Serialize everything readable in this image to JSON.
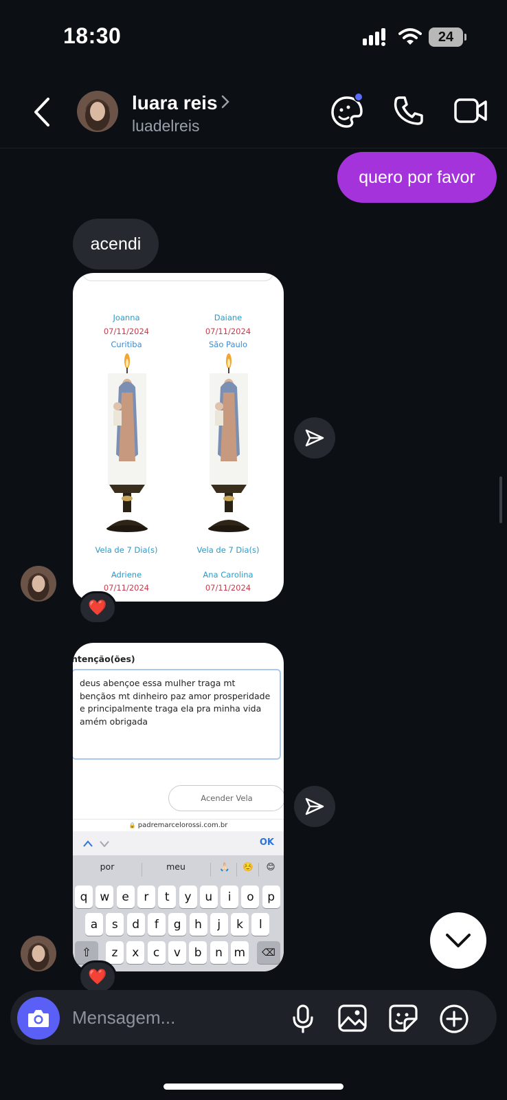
{
  "status": {
    "time": "18:30",
    "battery": "24"
  },
  "header": {
    "name": "luara reis",
    "username": "luadelreis"
  },
  "messages": {
    "outgoing_1": "quero por favor",
    "incoming_1": "acendi"
  },
  "candles": {
    "top": [
      {
        "name": "Joanna",
        "date": "07/11/2024",
        "city": "Curitiba",
        "type": "Vela de 7 Dia(s)"
      },
      {
        "name": "Daiane",
        "date": "07/11/2024",
        "city": "São Paulo",
        "type": "Vela de 7 Dia(s)"
      }
    ],
    "bottom": [
      {
        "name": "Adriene",
        "date": "07/11/2024"
      },
      {
        "name": "Ana Carolina",
        "date": "07/11/2024"
      }
    ]
  },
  "form": {
    "title": "ntenção(ões)",
    "intention": "deus abençoe essa mulher traga mt bençãos mt dinheiro paz amor prosperidade e principalmente traga ela pra minha vida amém obrigada",
    "button": "Acender Vela",
    "url": "padremarcelorossi.com.br"
  },
  "keyboard": {
    "ok": "OK",
    "suggestions": [
      "por",
      "meu"
    ],
    "emoji_suggestions": [
      "🙏🏻",
      "☺️",
      "😊"
    ],
    "row1": [
      "q",
      "w",
      "e",
      "r",
      "t",
      "y",
      "u",
      "i",
      "o",
      "p"
    ],
    "row2": [
      "a",
      "s",
      "d",
      "f",
      "g",
      "h",
      "j",
      "k",
      "l"
    ],
    "row3": [
      "z",
      "x",
      "c",
      "v",
      "b",
      "n",
      "m"
    ]
  },
  "reaction": "❤️",
  "composer": {
    "placeholder": "Mensagem..."
  },
  "colors": {
    "outgoing_bubble": "#a533dc",
    "incoming_bubble": "#262930",
    "camera_button": "#5a5ff5",
    "background": "#0c0f14"
  }
}
